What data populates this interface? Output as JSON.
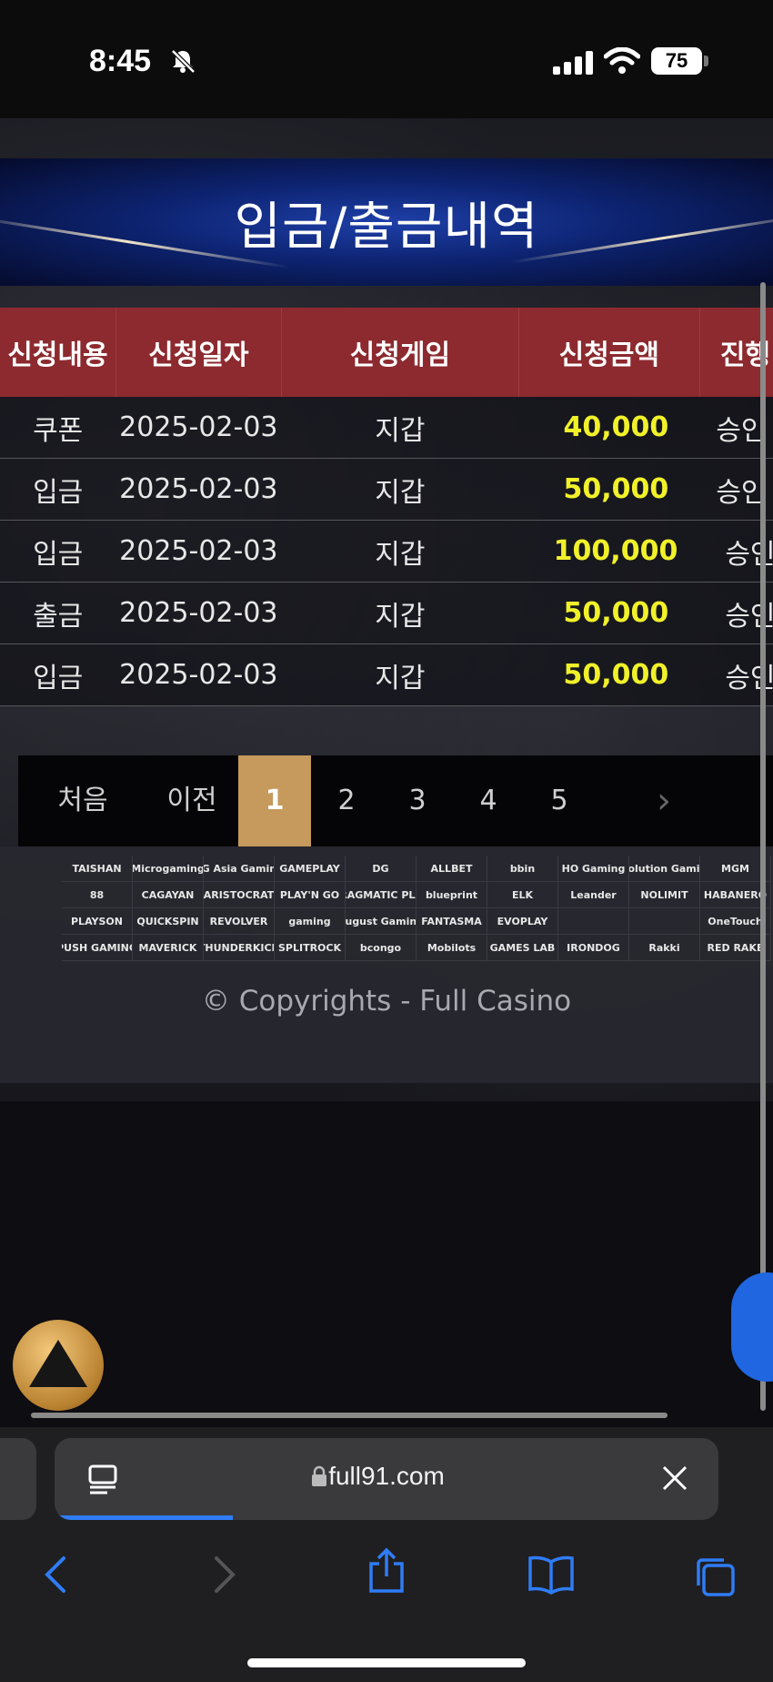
{
  "status_bar": {
    "time": "8:45",
    "battery": "75"
  },
  "banner": {
    "title": "입금/출금내역"
  },
  "table": {
    "headers": [
      "신청내용",
      "신청일자",
      "신청게임",
      "신청금액",
      "진행"
    ],
    "rows": [
      {
        "type": "쿠폰",
        "date": "2025-02-03",
        "game": "지갑",
        "amount": "40,000",
        "status": "승인"
      },
      {
        "type": "입금",
        "date": "2025-02-03",
        "game": "지갑",
        "amount": "50,000",
        "status": "승인"
      },
      {
        "type": "입금",
        "date": "2025-02-03",
        "game": "지갑",
        "amount": "100,000",
        "status": "승인"
      },
      {
        "type": "출금",
        "date": "2025-02-03",
        "game": "지갑",
        "amount": "50,000",
        "status": "승인"
      },
      {
        "type": "입금",
        "date": "2025-02-03",
        "game": "지갑",
        "amount": "50,000",
        "status": "승인"
      }
    ]
  },
  "pager": {
    "first": "처음",
    "prev": "이전",
    "pages": [
      "1",
      "2",
      "3",
      "4",
      "5"
    ],
    "current": "1",
    "next": "›"
  },
  "providers": [
    "TAISHAN",
    "Microgaming",
    "AG Asia Gaming",
    "GAMEPLAY",
    "DG",
    "ALLBET",
    "bbin",
    "HO Gaming",
    "Evolution Gaming",
    "MGM",
    "88",
    "CAGAYAN",
    "ARISTOCRAT",
    "PLAY'N GO",
    "PRAGMATIC PLAY",
    "blueprint",
    "ELK",
    "Leander",
    "NOLIMIT",
    "HABANERO",
    "PLAYSON",
    "QUICKSPIN",
    "REVOLVER",
    "gaming",
    "August Gaming",
    "FANTASMA",
    "EVOPLAY",
    "",
    "",
    "OneTouch",
    "PUSH GAMING",
    "MAVERICK",
    "THUNDERKICK",
    "SPLITROCK",
    "bcongo",
    "Mobilots",
    "GAMES LAB",
    "IRONDOG",
    "Rakki",
    "RED RAKE"
  ],
  "footer": {
    "copyright": "© Copyrights - Full Casino"
  },
  "browser": {
    "url": "full91.com"
  },
  "colors": {
    "header_red": "#8c2a2f",
    "amount_yellow": "#f1f12a",
    "pager_active": "#c59a5c",
    "banner_blue": "#1e3fa8"
  }
}
